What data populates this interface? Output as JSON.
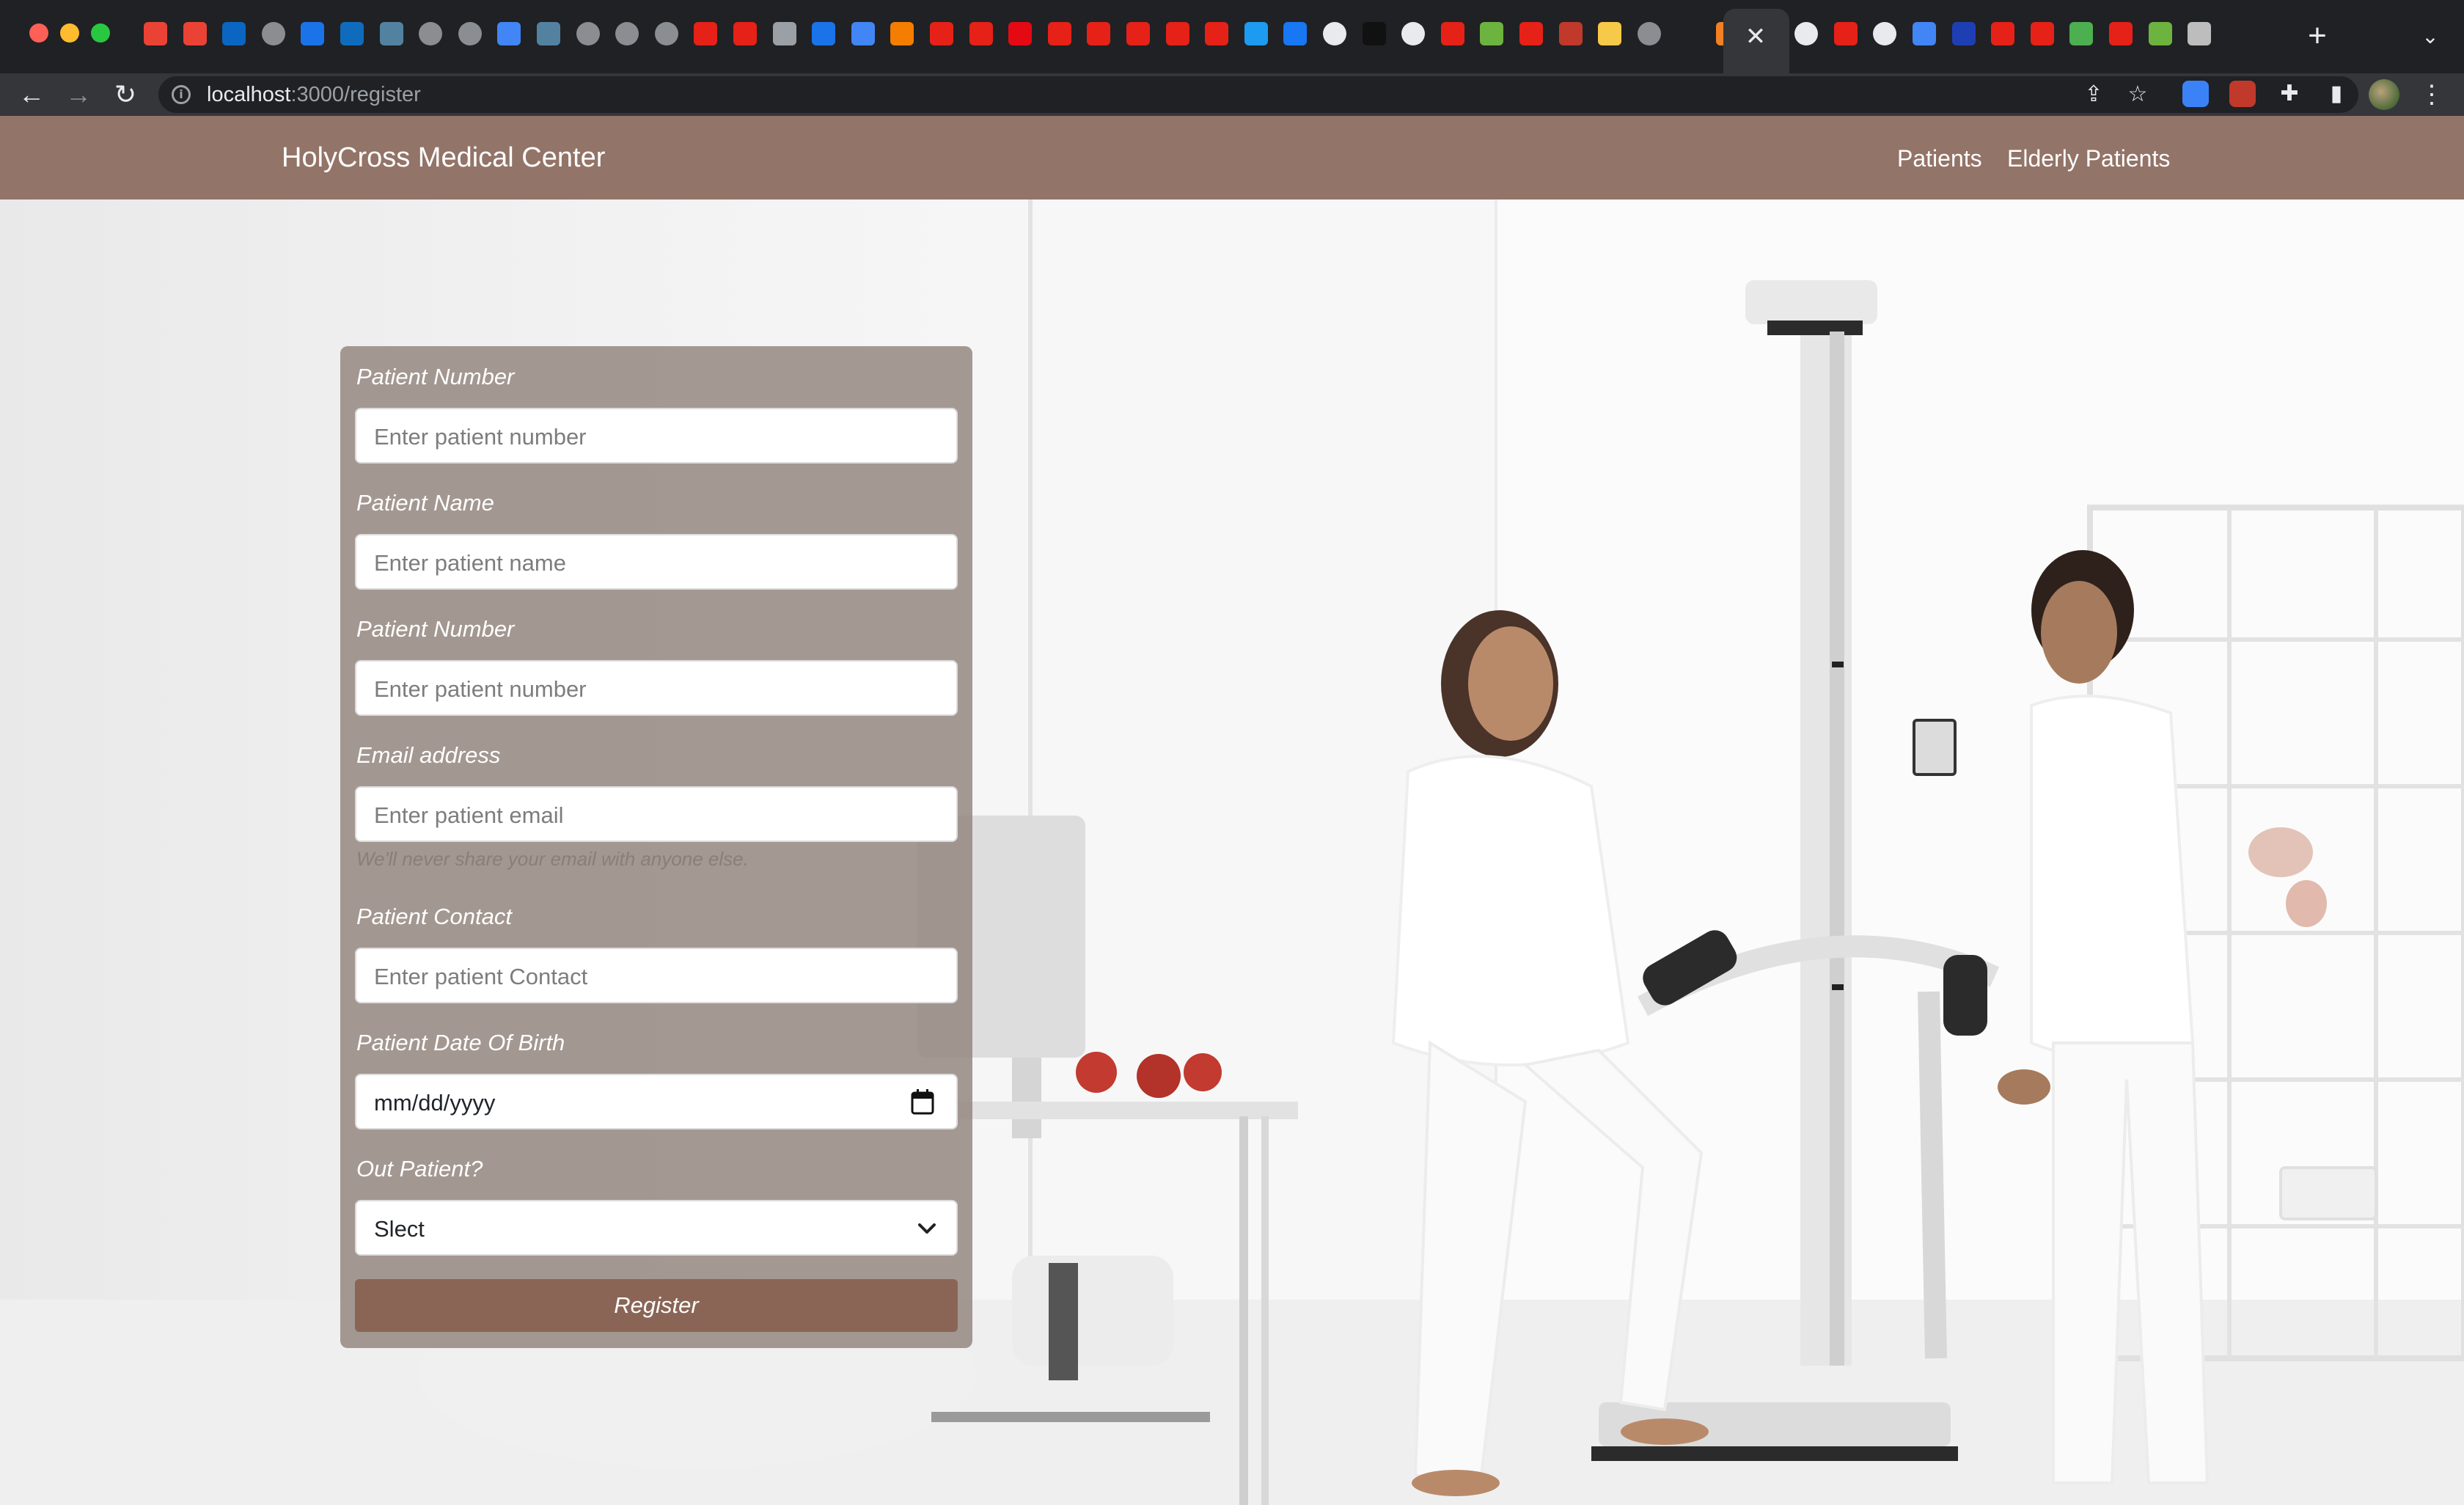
{
  "browser": {
    "url_host": "localhost",
    "url_path": ":3000/register",
    "tab_icons": [
      "gmail",
      "gmail",
      "linkedin",
      "globe",
      "video",
      "outlook",
      "java",
      "globe",
      "globe",
      "google",
      "java",
      "globe",
      "globe",
      "globe",
      "youtube",
      "youtube",
      "box",
      "c-logo",
      "google",
      "blogger",
      "youtube",
      "youtube",
      "netflix",
      "youtube",
      "youtube",
      "youtube",
      "youtube",
      "youtube",
      "twitter",
      "facebook",
      "medium",
      "dark-app",
      "is",
      "youtube",
      "spring",
      "youtube",
      "j-logo",
      "react-like",
      "globe",
      "close",
      "stackoverflow",
      "react",
      "github",
      "youtube",
      "github",
      "google",
      "flag",
      "youtube",
      "youtube",
      "leaf",
      "youtube",
      "spring",
      "font-a"
    ]
  },
  "navbar": {
    "brand": "HolyCross Medical Center",
    "links": [
      "Patients",
      "Elderly Patients"
    ]
  },
  "form": {
    "fields": [
      {
        "label": "Patient Number",
        "placeholder": "Enter patient number"
      },
      {
        "label": "Patient Name",
        "placeholder": "Enter patient name"
      },
      {
        "label": "Patient Number",
        "placeholder": "Enter patient number"
      },
      {
        "label": "Email address",
        "placeholder": "Enter patient email"
      },
      {
        "label": "Patient Contact",
        "placeholder": "Enter patient Contact"
      },
      {
        "label": "Patient Date Of Birth",
        "placeholder": "mm/dd/yyyy"
      },
      {
        "label": "Out Patient?",
        "selected": "Slect"
      }
    ],
    "email_help": "We'll never share your email with anyone else.",
    "submit_label": "Register"
  },
  "colors": {
    "navbar": "#937468",
    "card": "#968881",
    "button": "#8a6556"
  }
}
